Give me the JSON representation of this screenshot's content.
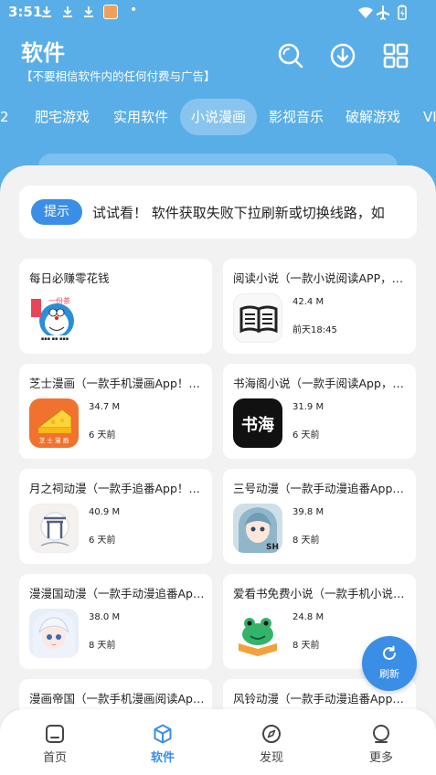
{
  "status": {
    "time": "3:51",
    "dot": "•"
  },
  "header": {
    "title": "软件",
    "subtitle": "【不要相信软件内的任何付费与广告】"
  },
  "tabs": [
    {
      "label": "2"
    },
    {
      "label": "肥宅游戏"
    },
    {
      "label": "实用软件"
    },
    {
      "label": "小说漫画",
      "active": true
    },
    {
      "label": "影视音乐"
    },
    {
      "label": "破解游戏"
    },
    {
      "label": "VI"
    }
  ],
  "notice": {
    "badge": "提示",
    "text": "试试看！  软件获取失败下拉刷新或切换线路，如"
  },
  "apps": [
    {
      "title": "每日必赚零花钱",
      "size": "",
      "date": "",
      "icon": "doraemon-app-icon",
      "icon_text": "一份茶"
    },
    {
      "title": "阅读小说（一款小说阅读APP，海量小说）",
      "size": "42.4 M",
      "date": "前天18:45",
      "icon": "book-app-icon"
    },
    {
      "title": "芝士漫画（一款手机漫画App！芝士漫画）",
      "size": "34.7 M",
      "date": "6 天前",
      "icon": "cheese-app-icon",
      "icon_text": "芝 士 漫 画"
    },
    {
      "title": "书海阁小说（一款手阅读App，海量小说）",
      "size": "31.9 M",
      "date": "6 天前",
      "icon": "shuhai-app-icon",
      "icon_text": "书海"
    },
    {
      "title": "月之祠动漫（一款手追番App！月之祠）",
      "size": "40.9 M",
      "date": "6 天前",
      "icon": "shrine-app-icon"
    },
    {
      "title": "三号动漫（一款手动漫追番App！三号动漫）",
      "size": "39.8 M",
      "date": "8 天前",
      "icon": "anime-girl-app-icon",
      "icon_text": "SH"
    },
    {
      "title": "漫漫国动漫（一款手动漫追番App！漫漫国）",
      "size": "38.0 M",
      "date": "8 天前",
      "icon": "anime-white-hair-app-icon"
    },
    {
      "title": "爱看书免费小说（一款手机小说阅读App）",
      "size": "24.8 M",
      "date": "8 天前",
      "icon": "frog-book-app-icon"
    },
    {
      "title": "漫画帝国（一款手机漫画阅读App！漫画帝国）",
      "size": "",
      "date": "",
      "icon": ""
    },
    {
      "title": "风铃动漫（一款手动漫追番App！风铃动漫）",
      "size": "",
      "date": "",
      "icon": ""
    }
  ],
  "fab": {
    "label": "刷新"
  },
  "nav": [
    {
      "label": "首页",
      "icon": "home-icon"
    },
    {
      "label": "软件",
      "icon": "apps-cube-icon",
      "active": true
    },
    {
      "label": "发现",
      "icon": "compass-icon"
    },
    {
      "label": "更多",
      "icon": "more-circle-icon"
    }
  ],
  "colors": {
    "header_bg": "#5aaee7",
    "accent": "#3b8ee6",
    "panel_bg": "#f2f2f2",
    "card_bg": "#ffffff"
  }
}
